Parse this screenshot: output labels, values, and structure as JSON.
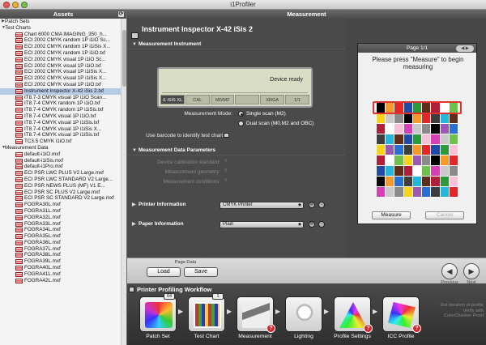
{
  "window": {
    "title": "i1Profiler"
  },
  "sidebar": {
    "header": "Assets",
    "groups": [
      {
        "label": "Patch Sets",
        "expanded": false
      },
      {
        "label": "Test Charts",
        "expanded": true
      }
    ],
    "test_charts": [
      "Chart 6000 CMA IMAGING_350_h...",
      "ECI 2002 CMYK random 1P i1iO Sc...",
      "ECI 2002 CMYK random 1P i1iSis X...",
      "ECI 2002 CMYK random 1P i1iO.txf",
      "ECI 2002 CMYK visual 1P i1iO Sc...",
      "ECI 2002 CMYK visual 1P i1iO.txf",
      "ECI 2002 CMYK visual 1P i1iSis X...",
      "ECI 2002 CMYK visual 1P i1iSis X...",
      "ECI 2002 CMYK visual 1P i1iO.txf",
      "Instrument Inspector X-42 iSis 2.txf",
      "IT8.7-3 CMYK visual 1P i1iO Scan...",
      "IT8.7-4 CMYK random 1P i1iO.txf",
      "IT8.7-4 CMYK random 1P i1iSis.txf",
      "IT8.7-4 CMYK visual 1P i1iO.txf",
      "IT8.7-4 CMYK visual 1P i1iSis.txf",
      "IT8.7-4 CMYK visual 1P i1iSis X...",
      "IT8.7-4 CMYK visual 1P i1iSis.txf",
      "TC3.5 CMYK i1iO.txf"
    ],
    "selected_index": 9,
    "measurement_group": "Measurement Data",
    "measurement_data": [
      "default-i1iO.mxf",
      "default-i1iSis.mxf",
      "default-i1Pro.mxf",
      "ECI PSR LWC PLUS V2 Large.mxf",
      "ECI PSR LWC STANDARD V2 Large...",
      "ECI PSR NEWS PLUS (MF) V1 E...",
      "ECI PSR SC PLUS V2 Large.mxf",
      "ECI PSR SC STANDARD V2 Large.mxf",
      "FOGRA30L.mxf",
      "FOGRA31L.mxf",
      "FOGRA32L.mxf",
      "FOGRA33L.mxf",
      "FOGRA34L.mxf",
      "FOGRA35L.mxf",
      "FOGRA36L.mxf",
      "FOGRA37L.mxf",
      "FOGRA38L.mxf",
      "FOGRA39L.mxf",
      "FOGRA40L.mxf",
      "FOGRA41L.mxf",
      "FOGRA42L.mxf"
    ]
  },
  "main": {
    "header": "Measurement",
    "device_title": "Instrument Inspector X-42 iSis 2",
    "sections": {
      "instrument": "Measurement Instrument",
      "data_params": "Measurement Data Parameters",
      "printer": "Printer Information",
      "paper": "Paper Information"
    },
    "lcd": {
      "status": "Device ready",
      "segments": [
        "i1 iSIS XL",
        "CAL",
        "M0/M2",
        "",
        "XRGA",
        "1/1"
      ]
    },
    "measurement_mode_label": "Measurement Mode:",
    "modes": [
      "Single scan (M2)",
      "Dual scan (M0,M2 and OBC)"
    ],
    "mode_selected": 0,
    "barcode_label": "Use barcode to identify test chart:",
    "dim_params": [
      "Device calibration standard:",
      "Measurement geometry:",
      "Measurement conditions:"
    ],
    "printer_value": "CMYK Printer",
    "paper_value": "Plain"
  },
  "preview": {
    "page": "Page 1/1",
    "message": "Please press \"Measure\" to begin measuring",
    "measure_button": "Measure",
    "cancel_button": "Cancel"
  },
  "page_data": {
    "label": "Page Data",
    "load": "Load",
    "save": "Save",
    "previous": "Previous",
    "next": "Next"
  },
  "workflow": {
    "title": "Printer Profiling Workflow",
    "steps": [
      {
        "label": "Patch Set",
        "badge": "64"
      },
      {
        "label": "Test Chart",
        "badge": "1"
      },
      {
        "label": "Measurement",
        "badge": ""
      },
      {
        "label": "Lighting",
        "badge": ""
      },
      {
        "label": "Profile Settings",
        "badge": ""
      },
      {
        "label": "ICC Profile",
        "badge": ""
      }
    ],
    "note": "2nd iteration of profile Verify with ColorChecker Proof",
    "warn_symbol": "?"
  },
  "colors": {
    "selection": "#b7cbe6",
    "highlight_frame": "#e0322f",
    "warning": "#d6262a"
  }
}
